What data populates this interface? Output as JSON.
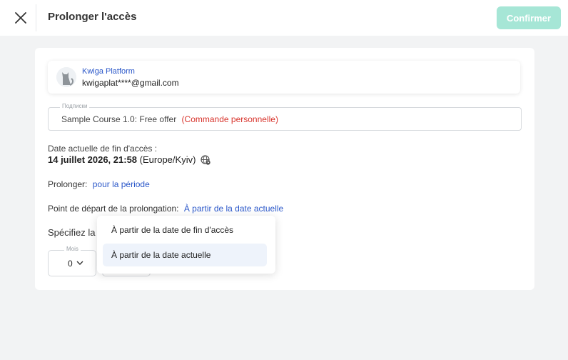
{
  "header": {
    "title": "Prolonger l'accès",
    "confirm_label": "Confirmer"
  },
  "user": {
    "name": "Kwiga Platform",
    "email": "kwigaplat****@gmail.com"
  },
  "subscription": {
    "legend": "Подписки",
    "value": "Sample Course 1.0: Free offer",
    "type": "(Commande personnelle)"
  },
  "access_end": {
    "label": "Date actuelle de fin d'accès :",
    "value": "14 juillet 2026, 21:58",
    "timezone": "(Europe/Kyiv)"
  },
  "extend": {
    "label": "Prolonger:",
    "value": "pour la période"
  },
  "start_point": {
    "label": "Point de départ de la prolongation:",
    "value": "À partir de la date actuelle"
  },
  "period": {
    "label": "Spécifiez la p",
    "month_legend": "Mois",
    "month_value": "0"
  },
  "dropdown": {
    "options": [
      {
        "label": "À partir de la date de fin d'accès"
      },
      {
        "label": "À partir de la date actuelle"
      }
    ]
  },
  "colors": {
    "accent": "#2a57c9",
    "confirm_disabled": "#a6e6d6",
    "warning": "#d8342c"
  }
}
